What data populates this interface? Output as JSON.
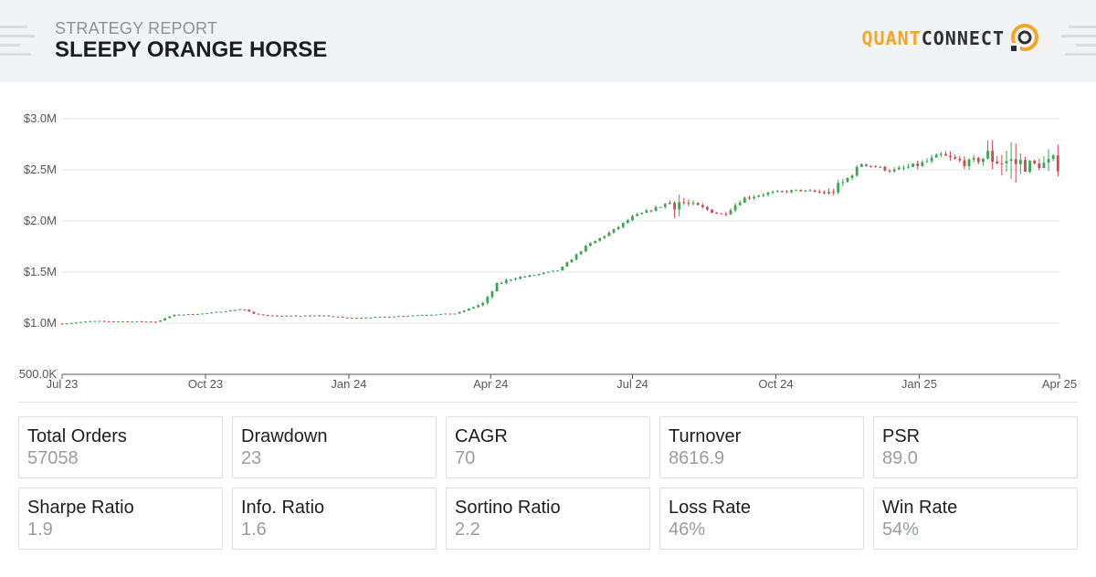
{
  "header": {
    "subtitle": "STRATEGY REPORT",
    "title": "SLEEPY ORANGE HORSE",
    "logo": {
      "part1": "QUANT",
      "part2": "CONNECT",
      "icon": "quantconnect-logo-icon"
    }
  },
  "colors": {
    "up": "#3aa652",
    "down": "#d9464d",
    "accent": "#f5a623",
    "grid": "#e6e7ea"
  },
  "chart_data": {
    "type": "candlestick",
    "title": "",
    "xlabel": "",
    "ylabel": "",
    "ylim": [
      500000,
      3000000
    ],
    "y_ticks": [
      {
        "value": 3000000,
        "label": "$3.0M"
      },
      {
        "value": 2500000,
        "label": "$2.5M"
      },
      {
        "value": 2000000,
        "label": "$2.0M"
      },
      {
        "value": 1500000,
        "label": "$1.5M"
      },
      {
        "value": 1000000,
        "label": "$1.0M"
      },
      {
        "value": 500000,
        "label": "500.0K"
      }
    ],
    "x_range": [
      "2023-07-01",
      "2025-04-01"
    ],
    "x_ticks": [
      {
        "date": "2023-07-01",
        "label": "Jul 23"
      },
      {
        "date": "2023-10-01",
        "label": "Oct 23"
      },
      {
        "date": "2024-01-01",
        "label": "Jan 24"
      },
      {
        "date": "2024-04-01",
        "label": "Apr 24"
      },
      {
        "date": "2024-07-01",
        "label": "Jul 24"
      },
      {
        "date": "2024-10-01",
        "label": "Oct 24"
      },
      {
        "date": "2025-01-01",
        "label": "Jan 25"
      },
      {
        "date": "2025-04-01",
        "label": "Apr 25"
      }
    ],
    "equity_path": [
      [
        "2023-07-01",
        995000
      ],
      [
        "2023-07-20",
        1020000
      ],
      [
        "2023-08-31",
        1015000
      ],
      [
        "2023-09-10",
        1080000
      ],
      [
        "2023-10-01",
        1095000
      ],
      [
        "2023-10-25",
        1140000
      ],
      [
        "2023-11-01",
        1090000
      ],
      [
        "2023-11-15",
        1070000
      ],
      [
        "2023-12-15",
        1075000
      ],
      [
        "2024-01-01",
        1050000
      ],
      [
        "2024-01-20",
        1060000
      ],
      [
        "2024-02-15",
        1080000
      ],
      [
        "2024-03-10",
        1095000
      ],
      [
        "2024-03-28",
        1200000
      ],
      [
        "2024-04-05",
        1380000
      ],
      [
        "2024-04-15",
        1440000
      ],
      [
        "2024-04-25",
        1460000
      ],
      [
        "2024-05-15",
        1520000
      ],
      [
        "2024-06-01",
        1750000
      ],
      [
        "2024-06-20",
        1920000
      ],
      [
        "2024-07-01",
        2040000
      ],
      [
        "2024-07-20",
        2150000
      ],
      [
        "2024-07-28",
        2200000
      ],
      [
        "2024-08-10",
        2150000
      ],
      [
        "2024-08-28",
        2060000
      ],
      [
        "2024-09-10",
        2220000
      ],
      [
        "2024-09-25",
        2270000
      ],
      [
        "2024-10-15",
        2300000
      ],
      [
        "2024-11-05",
        2270000
      ],
      [
        "2024-11-15",
        2400000
      ],
      [
        "2024-11-25",
        2560000
      ],
      [
        "2024-12-15",
        2490000
      ],
      [
        "2025-01-01",
        2550000
      ],
      [
        "2025-01-15",
        2640000
      ],
      [
        "2025-02-01",
        2560000
      ],
      [
        "2025-02-15",
        2640000
      ],
      [
        "2025-03-01",
        2570000
      ],
      [
        "2025-03-15",
        2550000
      ],
      [
        "2025-04-01",
        2560000
      ]
    ],
    "volatility_path": [
      [
        "2023-07-01",
        0.004
      ],
      [
        "2024-03-20",
        0.005
      ],
      [
        "2024-03-28",
        0.02
      ],
      [
        "2024-05-01",
        0.008
      ],
      [
        "2024-07-20",
        0.01
      ],
      [
        "2024-07-27",
        0.08
      ],
      [
        "2024-08-05",
        0.02
      ],
      [
        "2024-10-20",
        0.006
      ],
      [
        "2024-11-10",
        0.03
      ],
      [
        "2024-11-25",
        0.01
      ],
      [
        "2025-02-10",
        0.025
      ],
      [
        "2025-02-18",
        0.09
      ],
      [
        "2025-03-05",
        0.09
      ],
      [
        "2025-03-15",
        0.02
      ],
      [
        "2025-03-28",
        0.06
      ],
      [
        "2025-04-01",
        0.05
      ]
    ]
  },
  "stats": [
    {
      "label": "Total Orders",
      "value": "57058"
    },
    {
      "label": "Drawdown",
      "value": "23"
    },
    {
      "label": "CAGR",
      "value": "70"
    },
    {
      "label": "Turnover",
      "value": "8616.9"
    },
    {
      "label": "PSR",
      "value": "89.0"
    },
    {
      "label": "Sharpe Ratio",
      "value": "1.9"
    },
    {
      "label": "Info. Ratio",
      "value": "1.6"
    },
    {
      "label": "Sortino Ratio",
      "value": "2.2"
    },
    {
      "label": "Loss Rate",
      "value": "46%"
    },
    {
      "label": "Win Rate",
      "value": "54%"
    }
  ]
}
